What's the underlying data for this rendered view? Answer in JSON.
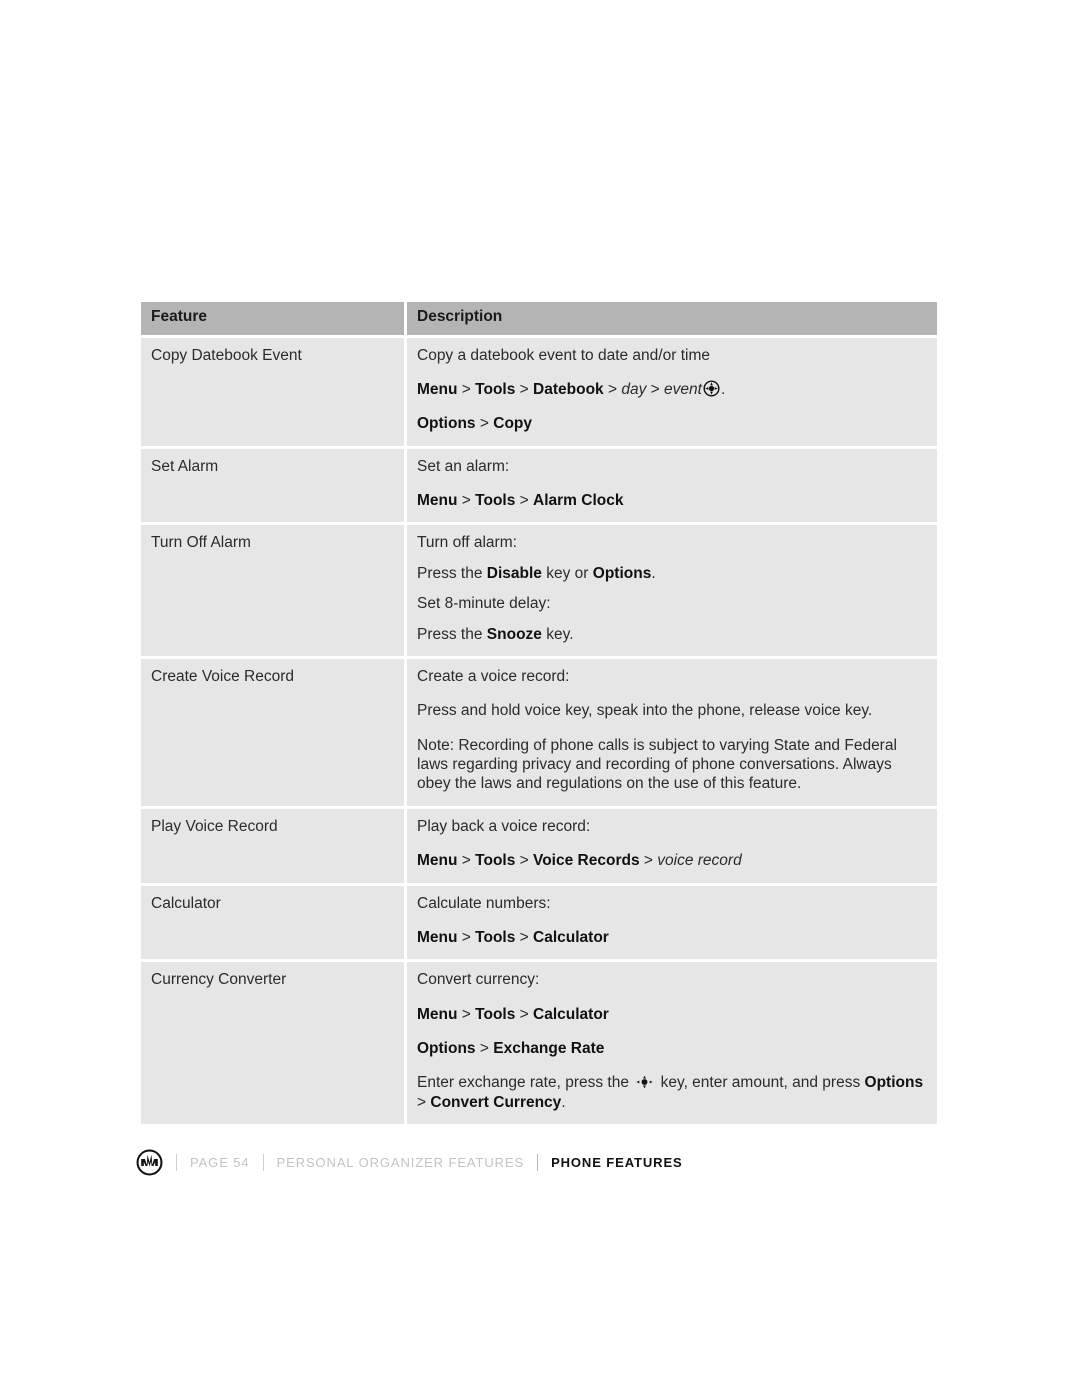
{
  "table": {
    "headers": {
      "feature": "Feature",
      "description": "Description"
    },
    "rows": [
      {
        "feature": "Copy Datebook Event",
        "lines": [
          "Copy a datebook event to date and/or time",
          "Menu > Tools > Datebook > day > event .",
          "Options > Copy"
        ]
      },
      {
        "feature": "Set Alarm",
        "lines": [
          "Set an alarm:",
          "Menu > Tools > Alarm Clock"
        ]
      },
      {
        "feature": "Turn Off Alarm",
        "lines": [
          "Turn off alarm:",
          "Press the Disable key or Options.",
          "Set 8-minute delay:",
          "Press the Snooze key."
        ]
      },
      {
        "feature": "Create Voice Record",
        "lines": [
          "Create a voice record:",
          "Press and hold voice key, speak into the phone, release voice key.",
          "Note: Recording of phone calls is subject to varying State and Federal laws regarding privacy and recording of phone conversations. Always obey the laws and regulations on the use of this feature."
        ]
      },
      {
        "feature": "Play Voice Record",
        "lines": [
          "Play back a voice record:",
          "Menu > Tools > Voice Records > voice record"
        ]
      },
      {
        "feature": "Calculator",
        "lines": [
          "Calculate numbers:",
          "Menu > Tools > Calculator"
        ]
      },
      {
        "feature": "Currency Converter",
        "lines": [
          "Convert currency:",
          "Menu > Tools > Calculator",
          "Options > Exchange Rate",
          "Enter exchange rate, press the  key, enter amount, and press Options > Convert Currency."
        ]
      }
    ]
  },
  "fragments": {
    "menu": "Menu",
    "tools": "Tools",
    "datebook": "Datebook",
    "day": "day",
    "event": "event",
    "options": "Options",
    "copy": "Copy",
    "alarm_clock": "Alarm Clock",
    "disable": "Disable",
    "snooze": "Snooze",
    "voice_records": "Voice Records",
    "voice_record": "voice record",
    "calculator": "Calculator",
    "exchange_rate": "Exchange Rate",
    "convert_currency": "Convert Currency",
    "gt": ">",
    "copy_datebook_desc": "Copy a datebook event to date and/or time",
    "set_an_alarm": "Set an alarm:",
    "turn_off_alarm": "Turn off alarm:",
    "press_the": "Press the",
    "key_or": "key or",
    "period": ".",
    "set_8_minute_delay": "Set 8-minute delay:",
    "key_period": "key.",
    "create_a_voice_record": "Create a voice record:",
    "press_and_hold": "Press and hold voice key, speak into the phone, release voice key.",
    "note_recording": "Note: Recording of phone calls is subject to varying State and Federal laws regarding privacy and recording of phone conversations. Always obey the laws and regulations on the use of this feature.",
    "play_back": "Play back a voice record:",
    "calculate_numbers": "Calculate numbers:",
    "convert_currency_label": "Convert currency:",
    "enter_exchange_rate": "Enter exchange rate, press the",
    "key_enter_amount": "key, enter amount, and press"
  },
  "footer": {
    "logo": "motorola-batwing-logo",
    "page": "PAGE 54",
    "section": "PERSONAL ORGANIZER FEATURES",
    "current": "PHONE FEATURES"
  },
  "colors": {
    "header_bg": "#b4b4b4",
    "cell_bg": "#e6e6e6",
    "page_bg": "#ffffff",
    "text": "#2b2b2b",
    "footer_muted": "#c3c3c3",
    "footer_active": "#111111"
  }
}
